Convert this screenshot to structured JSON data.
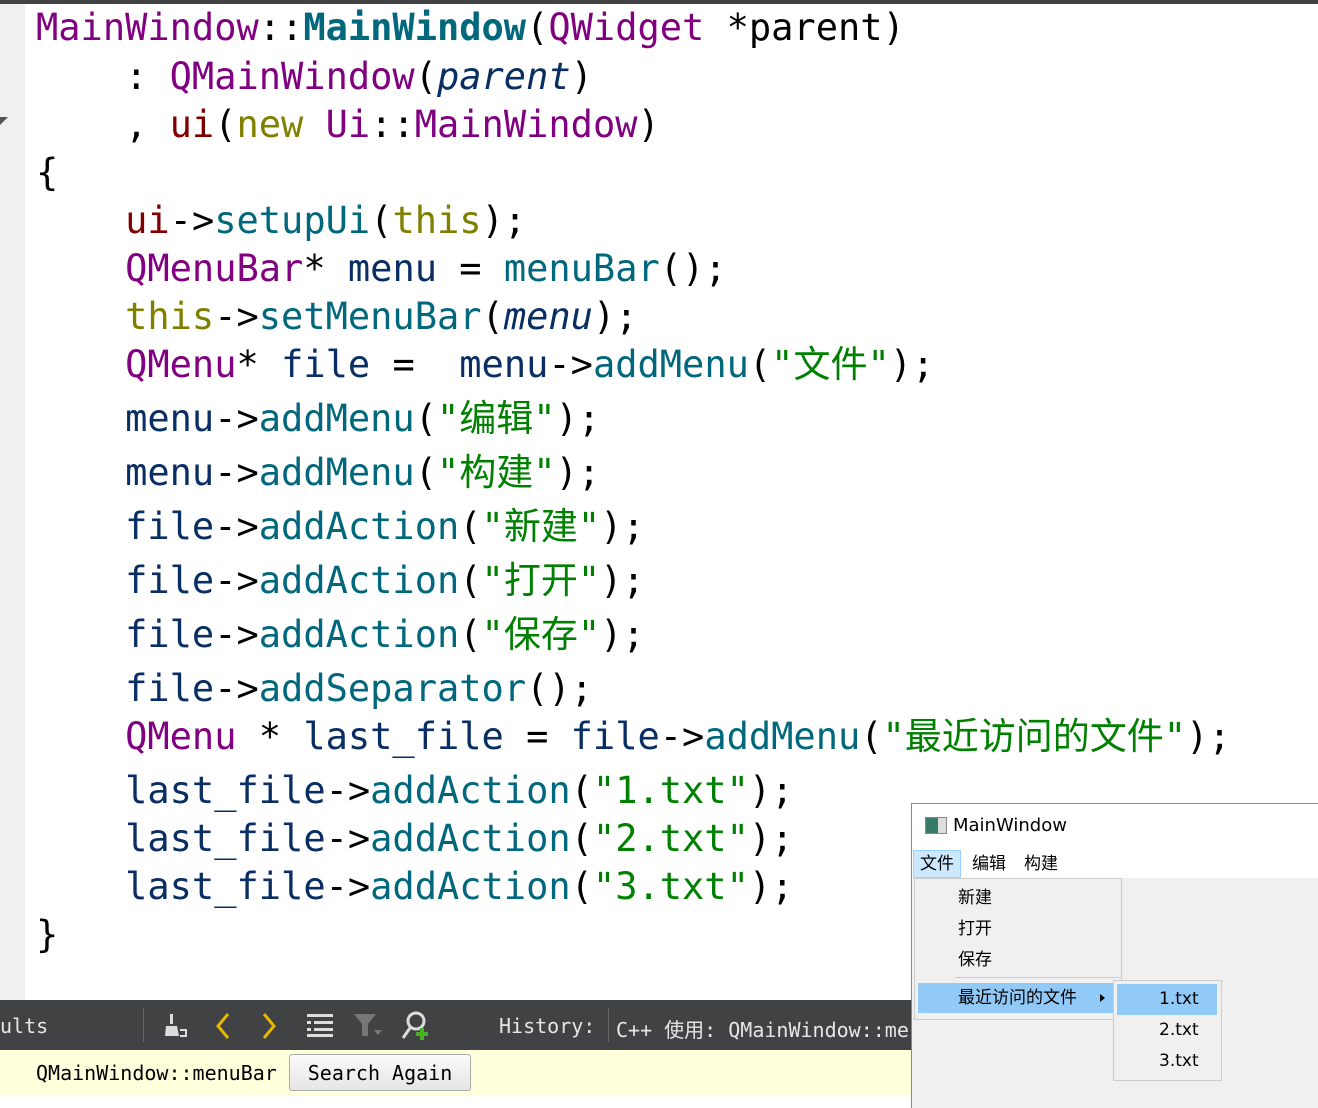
{
  "editor": {
    "lines": [
      [
        [
          "t",
          "MainWindow"
        ],
        [
          "p",
          "::"
        ],
        [
          "fb",
          "MainWindow"
        ],
        [
          "p",
          "("
        ],
        [
          "t",
          "QWidget"
        ],
        [
          "p",
          " *parent)"
        ]
      ],
      [
        [
          "p",
          "    : "
        ],
        [
          "t",
          "QMainWindow"
        ],
        [
          "p",
          "("
        ],
        [
          "li",
          "parent"
        ],
        [
          "p",
          ")"
        ]
      ],
      [
        [
          "p",
          "    , "
        ],
        [
          "m",
          "ui"
        ],
        [
          "p",
          "("
        ],
        [
          "k",
          "new"
        ],
        [
          "p",
          " "
        ],
        [
          "t",
          "Ui"
        ],
        [
          "p",
          "::"
        ],
        [
          "t",
          "MainWindow"
        ],
        [
          "p",
          ")"
        ]
      ],
      [
        [
          "p",
          "{"
        ]
      ],
      [
        [
          "p",
          "    "
        ],
        [
          "m",
          "ui"
        ],
        [
          "p",
          "->"
        ],
        [
          "f",
          "setupUi"
        ],
        [
          "p",
          "("
        ],
        [
          "k",
          "this"
        ],
        [
          "p",
          ");"
        ]
      ],
      [
        [
          "p",
          "    "
        ],
        [
          "t",
          "QMenuBar"
        ],
        [
          "p",
          "* "
        ],
        [
          "l",
          "menu"
        ],
        [
          "p",
          " = "
        ],
        [
          "f",
          "menuBar"
        ],
        [
          "p",
          "();"
        ]
      ],
      [
        [
          "p",
          "    "
        ],
        [
          "k",
          "this"
        ],
        [
          "p",
          "->"
        ],
        [
          "f",
          "setMenuBar"
        ],
        [
          "p",
          "("
        ],
        [
          "li",
          "menu"
        ],
        [
          "p",
          ");"
        ]
      ],
      [
        [
          "p",
          "    "
        ],
        [
          "t",
          "QMenu"
        ],
        [
          "p",
          "* "
        ],
        [
          "l",
          "file"
        ],
        [
          "p",
          " =  "
        ],
        [
          "l",
          "menu"
        ],
        [
          "p",
          "->"
        ],
        [
          "f",
          "addMenu"
        ],
        [
          "p",
          "("
        ],
        [
          "s",
          "\"文件\""
        ],
        [
          "p",
          ");"
        ]
      ],
      [
        [
          "p",
          "    "
        ],
        [
          "l",
          "menu"
        ],
        [
          "p",
          "->"
        ],
        [
          "f",
          "addMenu"
        ],
        [
          "p",
          "("
        ],
        [
          "s",
          "\"编辑\""
        ],
        [
          "p",
          ");"
        ]
      ],
      [
        [
          "p",
          "    "
        ],
        [
          "l",
          "menu"
        ],
        [
          "p",
          "->"
        ],
        [
          "f",
          "addMenu"
        ],
        [
          "p",
          "("
        ],
        [
          "s",
          "\"构建\""
        ],
        [
          "p",
          ");"
        ]
      ],
      [
        [
          "p",
          "    "
        ],
        [
          "l",
          "file"
        ],
        [
          "p",
          "->"
        ],
        [
          "f",
          "addAction"
        ],
        [
          "p",
          "("
        ],
        [
          "s",
          "\"新建\""
        ],
        [
          "p",
          ");"
        ]
      ],
      [
        [
          "p",
          "    "
        ],
        [
          "l",
          "file"
        ],
        [
          "p",
          "->"
        ],
        [
          "f",
          "addAction"
        ],
        [
          "p",
          "("
        ],
        [
          "s",
          "\"打开\""
        ],
        [
          "p",
          ");"
        ]
      ],
      [
        [
          "p",
          "    "
        ],
        [
          "l",
          "file"
        ],
        [
          "p",
          "->"
        ],
        [
          "f",
          "addAction"
        ],
        [
          "p",
          "("
        ],
        [
          "s",
          "\"保存\""
        ],
        [
          "p",
          ");"
        ]
      ],
      [
        [
          "p",
          "    "
        ],
        [
          "l",
          "file"
        ],
        [
          "p",
          "->"
        ],
        [
          "f",
          "addSeparator"
        ],
        [
          "p",
          "();"
        ]
      ],
      [
        [
          "p",
          "    "
        ],
        [
          "t",
          "QMenu"
        ],
        [
          "p",
          " * "
        ],
        [
          "l",
          "last_file"
        ],
        [
          "p",
          " = "
        ],
        [
          "l",
          "file"
        ],
        [
          "p",
          "->"
        ],
        [
          "f",
          "addMenu"
        ],
        [
          "p",
          "("
        ],
        [
          "s",
          "\"最近访问的文件\""
        ],
        [
          "p",
          ");"
        ]
      ],
      [
        [
          "p",
          "    "
        ],
        [
          "l",
          "last_file"
        ],
        [
          "p",
          "->"
        ],
        [
          "f",
          "addAction"
        ],
        [
          "p",
          "("
        ],
        [
          "s",
          "\"1.txt\""
        ],
        [
          "p",
          ");"
        ]
      ],
      [
        [
          "p",
          "    "
        ],
        [
          "l",
          "last_file"
        ],
        [
          "p",
          "->"
        ],
        [
          "f",
          "addAction"
        ],
        [
          "p",
          "("
        ],
        [
          "s",
          "\"2.txt\""
        ],
        [
          "p",
          ");"
        ]
      ],
      [
        [
          "p",
          "    "
        ],
        [
          "l",
          "last_file"
        ],
        [
          "p",
          "->"
        ],
        [
          "f",
          "addAction"
        ],
        [
          "p",
          "("
        ],
        [
          "s",
          "\"3.txt\""
        ],
        [
          "p",
          ");"
        ]
      ],
      [
        [
          "p",
          "}"
        ]
      ]
    ]
  },
  "search_panel": {
    "tab_label": "ults",
    "history_label": "History:",
    "history_value": "C++ 使用: QMainWindow::me",
    "search_term": "QMainWindow::menuBar",
    "search_again_label": "Search Again",
    "icons": [
      "clear-icon",
      "back-icon",
      "forward-icon",
      "expand-list-icon",
      "filter-icon",
      "new-search-icon"
    ]
  },
  "preview_window": {
    "title": "MainWindow",
    "menus": [
      "文件",
      "编辑",
      "构建"
    ],
    "file_menu_items": [
      "新建",
      "打开",
      "保存"
    ],
    "recent_submenu_label": "最近访问的文件",
    "recent_items": [
      "1.txt",
      "2.txt",
      "3.txt"
    ]
  },
  "colors": {
    "highlight": "#91c9f7",
    "menubar_active": "#cce8ff",
    "panel_dark": "#404244",
    "find_bar": "#ffffdc"
  }
}
